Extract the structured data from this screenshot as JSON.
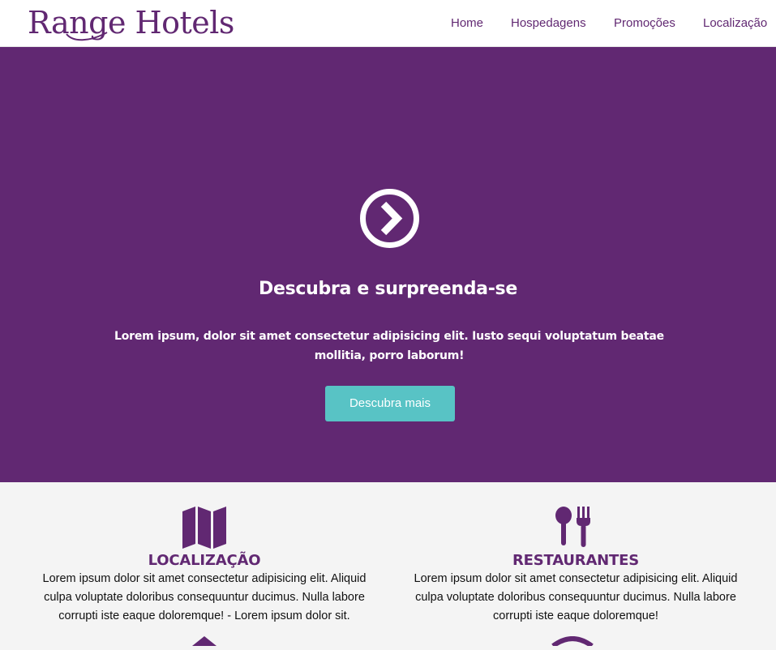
{
  "header": {
    "logo": "Range Hotels",
    "nav": [
      {
        "label": "Home"
      },
      {
        "label": "Hospedagens"
      },
      {
        "label": "Promoções"
      },
      {
        "label": "Localização"
      }
    ]
  },
  "hero": {
    "icon": "chevron-right-circle-icon",
    "title": "Descubra e surpreenda-se",
    "text": "Lorem ipsum, dolor sit amet consectetur adipisicing elit. Iusto sequi voluptatum beatae mollitia, porro laborum!",
    "button_label": "Descubra mais"
  },
  "features": [
    {
      "icon": "map-icon",
      "title": "LOCALIZAÇÃO",
      "text": "Lorem ipsum dolor sit amet consectetur adipisicing elit. Aliquid culpa voluptate doloribus consequuntur ducimus. Nulla labore corrupti iste eaque doloremque! - Lorem ipsum dolor sit."
    },
    {
      "icon": "utensils-icon",
      "title": "RESTAURANTES",
      "text": "Lorem ipsum dolor sit amet consectetur adipisicing elit. Aliquid culpa voluptate doloribus consequuntur ducimus. Nulla labore corrupti iste eaque doloremque!"
    }
  ],
  "colors": {
    "brand": "#612872",
    "accent": "#58c3c5",
    "background": "#f4f4f4"
  }
}
